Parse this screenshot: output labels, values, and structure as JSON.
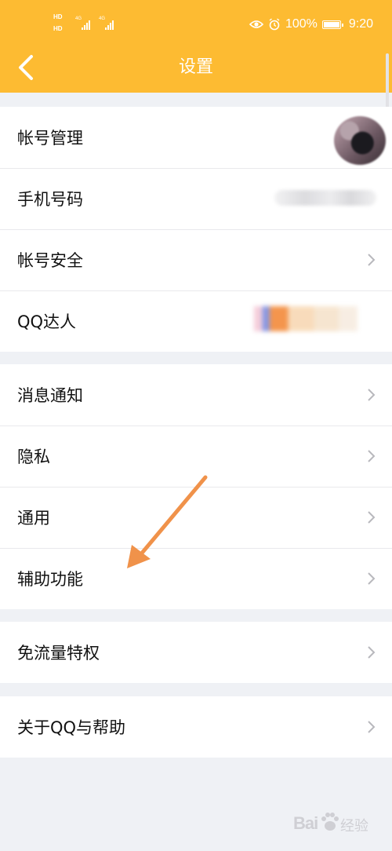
{
  "status_bar": {
    "hd_label": "HD",
    "network_4g": "4G",
    "network_4g_2": "4G",
    "eye_icon": "eye-comfort-icon",
    "alarm_icon": "alarm-icon",
    "battery_percent": "100%",
    "time": "9:20"
  },
  "header": {
    "back_icon": "back-arrow-icon",
    "title": "设置"
  },
  "sections": [
    {
      "rows": [
        {
          "label": "帐号管理"
        },
        {
          "label": "手机号码"
        },
        {
          "label": "帐号安全"
        },
        {
          "label": "QQ达人"
        }
      ]
    },
    {
      "rows": [
        {
          "label": "消息通知"
        },
        {
          "label": "隐私"
        },
        {
          "label": "通用"
        },
        {
          "label": "辅助功能"
        }
      ]
    },
    {
      "rows": [
        {
          "label": "免流量特权"
        }
      ]
    },
    {
      "rows": [
        {
          "label": "关于QQ与帮助"
        }
      ]
    }
  ],
  "annotation": {
    "color": "#f0924a"
  },
  "watermark": {
    "text": "Bai",
    "paw": "paw-icon",
    "suffix": "经验"
  },
  "colors": {
    "header": "#fdbb32",
    "background": "#eff1f5",
    "chevron": "#b8b8bd"
  }
}
